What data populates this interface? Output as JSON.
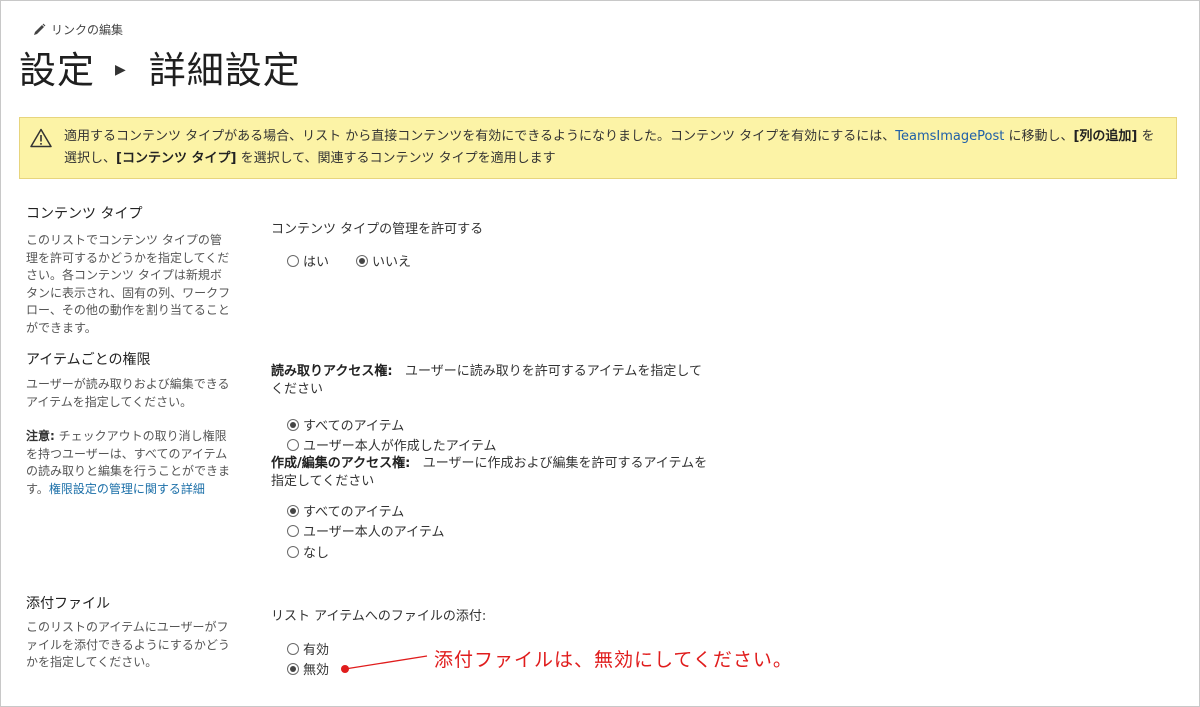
{
  "header": {
    "edit_link": "リンクの編集",
    "title_part1": "設定",
    "title_part2": "詳細設定"
  },
  "notice": {
    "text1": "適用するコンテンツ タイプがある場合、リスト から直接コンテンツを有効にできるようになりました。コンテンツ タイプを有効にするには、",
    "link": "TeamsImagePost",
    "text2": " に移動し、",
    "bold1": "[列の追加]",
    "text3": " を選択し、",
    "bold2": "[コンテンツ タイプ]",
    "text4": " を選択して、関連するコンテンツ タイプを適用します"
  },
  "content_types": {
    "title": "コンテンツ タイプ",
    "desc": "このリストでコンテンツ タイプの管理を許可するかどうかを指定してください。各コンテンツ タイプは新規ボタンに表示され、固有の列、ワークフロー、その他の動作を割り当てることができます。",
    "field_label": "コンテンツ タイプの管理を許可する",
    "options": [
      "はい",
      "いいえ"
    ],
    "selected": "いいえ"
  },
  "item_permissions": {
    "title": "アイテムごとの権限",
    "desc": "ユーザーが読み取りおよび編集できるアイテムを指定してください。",
    "note_label": "注意:",
    "note_text": " チェックアウトの取り消し権限を持つユーザーは、すべてのアイテムの読み取りと編集を行うことができます。",
    "note_link": "権限設定の管理に関する詳細",
    "read_label": "読み取りアクセス権:",
    "read_desc": "ユーザーに読み取りを許可するアイテムを指定してください",
    "read_options": [
      "すべてのアイテム",
      "ユーザー本人が作成したアイテム"
    ],
    "read_selected": "すべてのアイテム",
    "edit_label": "作成/編集のアクセス権:",
    "edit_desc": "ユーザーに作成および編集を許可するアイテムを指定してください",
    "edit_options": [
      "すべてのアイテム",
      "ユーザー本人のアイテム",
      "なし"
    ],
    "edit_selected": "すべてのアイテム"
  },
  "attachments": {
    "title": "添付ファイル",
    "desc": "このリストのアイテムにユーザーがファイルを添付できるようにするかどうかを指定してください。",
    "field_label": "リスト アイテムへのファイルの添付:",
    "options": [
      "有効",
      "無効"
    ],
    "selected": "無効"
  },
  "annotation": {
    "text": "添付ファイルは、無効にしてください。",
    "color": "#e01c1c"
  },
  "colors": {
    "notice_bg": "#fcf3a6",
    "link": "#2060a8"
  }
}
